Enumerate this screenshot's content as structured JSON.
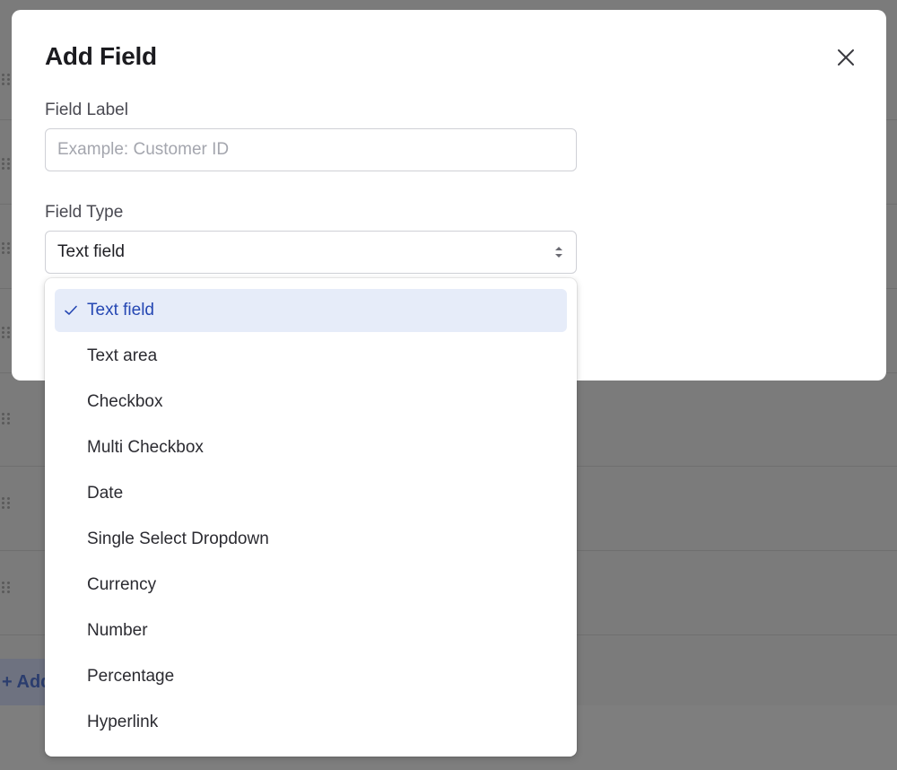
{
  "modal": {
    "title": "Add Field",
    "field_label": {
      "label": "Field Label",
      "placeholder": "Example: Customer ID",
      "value": ""
    },
    "field_type": {
      "label": "Field Type",
      "selected": "Text field"
    }
  },
  "dropdown": {
    "options": [
      "Text field",
      "Text area",
      "Checkbox",
      "Multi Checkbox",
      "Date",
      "Single Select Dropdown",
      "Currency",
      "Number",
      "Percentage",
      "Hyperlink"
    ],
    "selected_index": 0
  },
  "background": {
    "add_button_label": "+ Add"
  },
  "colors": {
    "overlay": "#7b7b7b",
    "selected_bg": "#e6ecf9",
    "selected_text": "#2547b3",
    "input_border": "#cfd0d6"
  },
  "icons": {
    "close": "close-icon",
    "select_arrows": "select-arrows-icon",
    "check": "check-icon",
    "drag_handle": "drag-handle-icon"
  }
}
